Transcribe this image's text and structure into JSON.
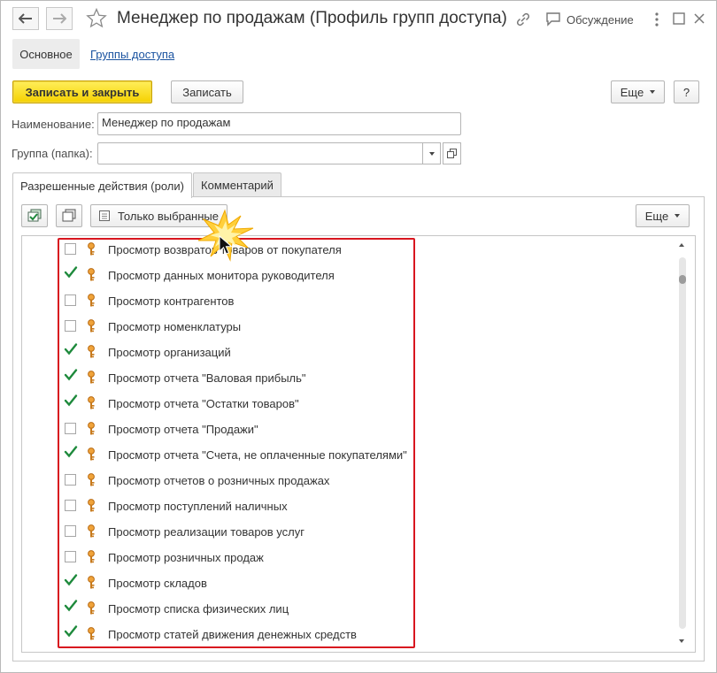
{
  "window": {
    "title": "Менеджер по продажам (Профиль групп доступа)",
    "discussion_label": "Обсуждение",
    "icons": [
      "back-arrow-icon",
      "forward-arrow-icon",
      "star-icon",
      "link-icon",
      "discussion-icon",
      "more-vertical-icon",
      "maximize-icon",
      "close-icon"
    ]
  },
  "sections": {
    "main_label": "Основное",
    "groups_link": "Группы доступа"
  },
  "command_bar": {
    "save_close": "Записать и закрыть",
    "save": "Записать",
    "more": "Еще",
    "help": "?"
  },
  "form": {
    "name_label": "Наименование:",
    "name_value": "Менеджер по продажам",
    "group_label": "Группа (папка):",
    "group_value": ""
  },
  "tabs": [
    {
      "label": "Разрешенные действия (роли)",
      "active": true
    },
    {
      "label": "Комментарий",
      "active": false
    }
  ],
  "roles_toolbar": {
    "only_selected": "Только выбранные",
    "more": "Еще"
  },
  "roles": [
    {
      "label": "Просмотр возвратов товаров от покупателя",
      "checked": false
    },
    {
      "label": "Просмотр данных монитора руководителя",
      "checked": true
    },
    {
      "label": "Просмотр контрагентов",
      "checked": false
    },
    {
      "label": "Просмотр номенклатуры",
      "checked": false
    },
    {
      "label": "Просмотр организаций",
      "checked": true
    },
    {
      "label": "Просмотр отчета \"Валовая прибыль\"",
      "checked": true
    },
    {
      "label": "Просмотр отчета \"Остатки товаров\"",
      "checked": true
    },
    {
      "label": "Просмотр отчета \"Продажи\"",
      "checked": false
    },
    {
      "label": "Просмотр отчета \"Счета, не оплаченные покупателями\"",
      "checked": true
    },
    {
      "label": "Просмотр отчетов о розничных продажах",
      "checked": false
    },
    {
      "label": "Просмотр поступлений наличных",
      "checked": false
    },
    {
      "label": "Просмотр реализации товаров услуг",
      "checked": false
    },
    {
      "label": "Просмотр розничных продаж",
      "checked": false
    },
    {
      "label": "Просмотр складов",
      "checked": true
    },
    {
      "label": "Просмотр списка физических лиц",
      "checked": true
    },
    {
      "label": "Просмотр статей движения денежных средств",
      "checked": true
    }
  ],
  "colors": {
    "primary_button": "#f5d100",
    "highlight_frame": "#d8161f",
    "check": "#1e8a3c",
    "link": "#1a53a0"
  }
}
